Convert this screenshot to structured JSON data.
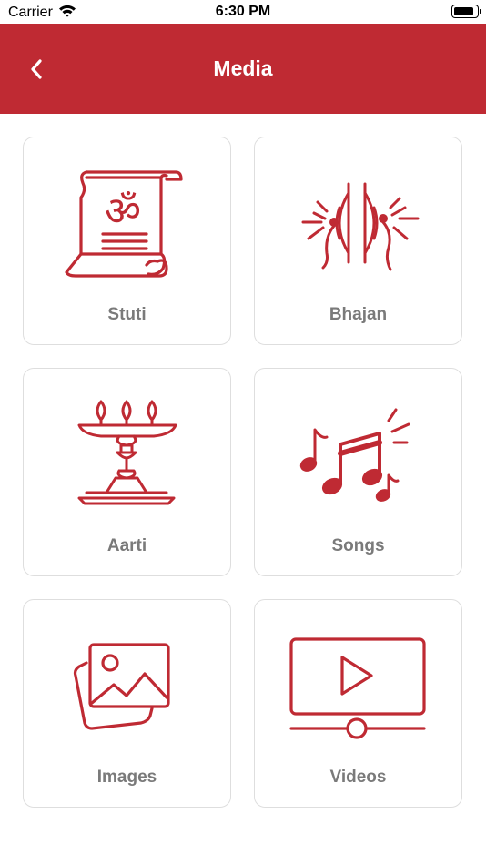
{
  "status_bar": {
    "carrier": "Carrier",
    "time": "6:30 PM",
    "battery_level": 0.9
  },
  "nav": {
    "title": "Media",
    "back_icon": "chevron-left-icon"
  },
  "accent_color": "#bf2a33",
  "menu": [
    {
      "label": "Stuti",
      "icon": "om-scroll-icon"
    },
    {
      "label": "Bhajan",
      "icon": "cymbals-icon"
    },
    {
      "label": "Aarti",
      "icon": "diya-lamp-icon"
    },
    {
      "label": "Songs",
      "icon": "music-notes-icon"
    },
    {
      "label": "Images",
      "icon": "image-gallery-icon"
    },
    {
      "label": "Videos",
      "icon": "video-player-icon"
    }
  ]
}
